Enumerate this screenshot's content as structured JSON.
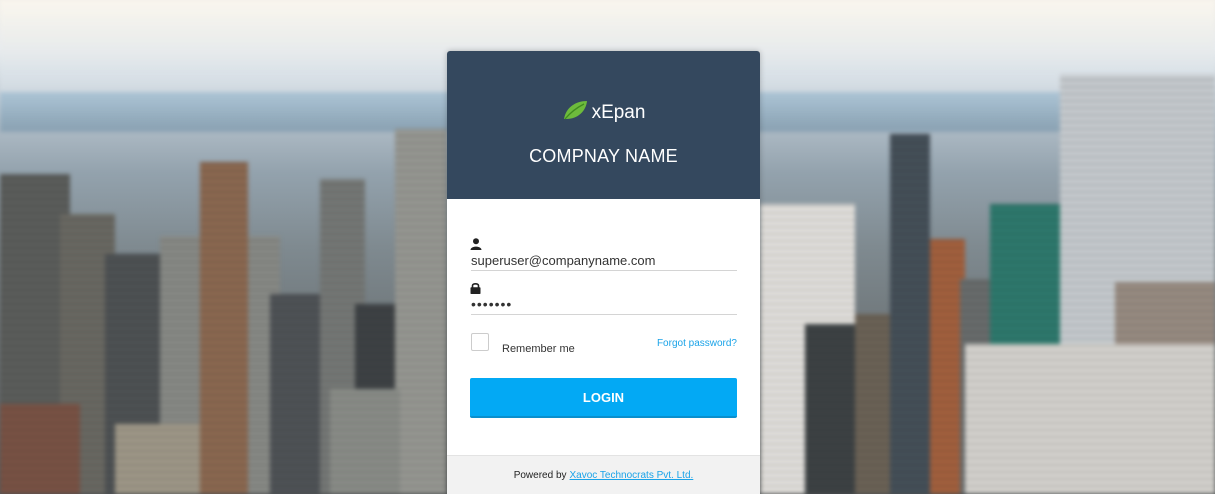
{
  "brand": {
    "name": "xEpan",
    "logo_icon": "leaf-icon",
    "logo_color": "#6dbb3c"
  },
  "company_name": "COMPNAY NAME",
  "login_form": {
    "username_icon": "user-icon",
    "username_value": "superuser@companyname.com",
    "password_icon": "lock-icon",
    "password_value": "•••••••",
    "remember_label": "Remember me",
    "remember_checked": false,
    "forgot_label": "Forgot password?",
    "submit_label": "LOGIN"
  },
  "footer": {
    "powered_by": "Powered by",
    "company_link": "Xavoc Technocrats Pvt. Ltd."
  },
  "colors": {
    "header_bg": "#34485e",
    "accent": "#03a9f4",
    "link": "#1aa3e8"
  }
}
